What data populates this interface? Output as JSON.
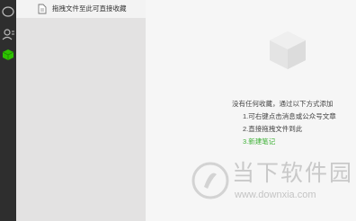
{
  "rail": {
    "icons": [
      "chat-bubble-icon",
      "contacts-icon",
      "favorites-cube-icon"
    ],
    "active_color": "#2dc100"
  },
  "drop_zone": {
    "icon": "document-icon",
    "label": "拖拽文件至此可直接收藏"
  },
  "empty_state": {
    "icon": "cube-icon",
    "intro": "没有任何收藏，通过以下方式添加",
    "steps": [
      "1.可右键点击消息或公众号文章",
      "2.直接拖拽文件到此",
      "3.新建笔记"
    ],
    "link_color": "#3cb034"
  },
  "watermark": {
    "title": "当下软件园",
    "url": "www.downxia.com"
  }
}
